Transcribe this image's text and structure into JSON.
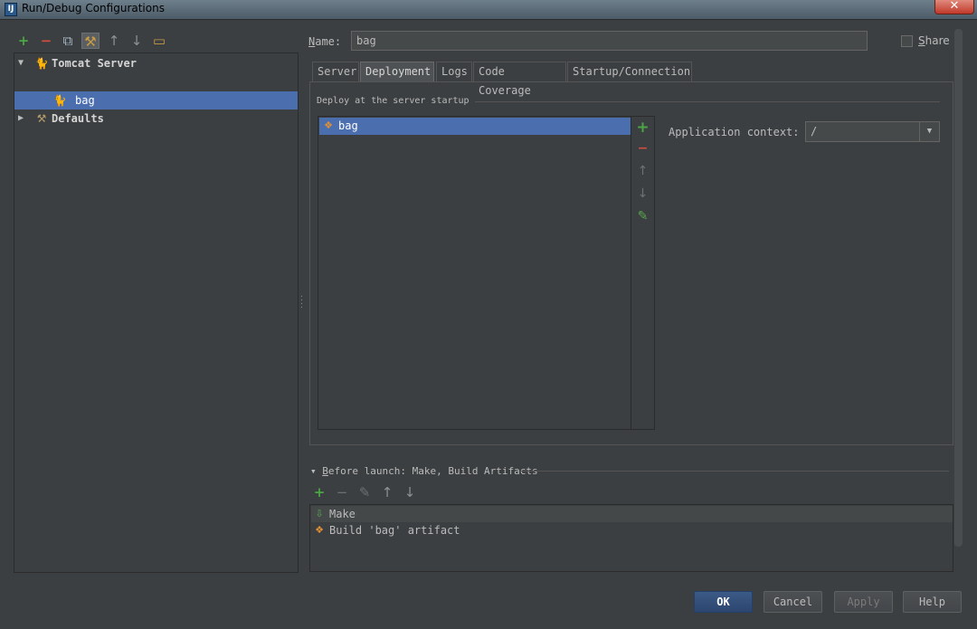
{
  "window": {
    "title": "Run/Debug Configurations",
    "logo_text": "IJ",
    "close_glyph": "✕"
  },
  "left_toolbar": [
    {
      "name": "add-icon",
      "glyph": "+"
    },
    {
      "name": "remove-icon",
      "glyph": "−"
    },
    {
      "name": "copy-icon",
      "glyph": "⧉"
    },
    {
      "name": "edit-defaults-icon",
      "glyph": "⚒"
    },
    {
      "name": "move-up-icon",
      "glyph": "↑"
    },
    {
      "name": "move-down-icon",
      "glyph": "↓"
    },
    {
      "name": "folder-icon",
      "glyph": "▭"
    }
  ],
  "tree": {
    "tomcat": {
      "label": "Tomcat Server",
      "expanded_glyph": "▼",
      "icon_glyph": "🐈"
    },
    "bag": {
      "label": "bag",
      "icon_glyph": "🐈"
    },
    "defaults": {
      "label": "Defaults",
      "collapsed_glyph": "▶",
      "icon_glyph": "⚒"
    }
  },
  "name_field": {
    "label_prefix": "N",
    "label_rest": "ame:",
    "value": "bag"
  },
  "share": {
    "label_prefix": "S",
    "label_rest": "hare",
    "checked": false
  },
  "tabs": [
    "Server",
    "Deployment",
    "Logs",
    "Code Coverage",
    "Startup/Connection"
  ],
  "active_tab": "Deployment",
  "deploy": {
    "group_title": "Deploy at the server startup",
    "items": [
      {
        "label": "bag",
        "icon_glyph": "❖"
      }
    ],
    "side_tools": [
      "+",
      "−",
      "↑",
      "↓",
      "✎"
    ]
  },
  "app_context": {
    "label": "Application context:",
    "value": "/",
    "arrow_glyph": "▼"
  },
  "before_launch": {
    "title_prefix": "▾ ",
    "title_u": "B",
    "title_rest": "efore launch: Make, Build Artifacts",
    "tools": [
      "+",
      "−",
      "✎",
      "↑",
      "↓"
    ],
    "items": [
      {
        "label": "Make",
        "icon_glyph": "⇩"
      },
      {
        "label": "Build 'bag' artifact",
        "icon_glyph": "❖"
      }
    ]
  },
  "buttons": {
    "ok": "OK",
    "cancel": "Cancel",
    "apply": "Apply",
    "help": "Help"
  },
  "colors": {
    "accent": "#4b6eaf",
    "background": "#3c3f41",
    "add": "#4ca544",
    "remove": "#d04e3f"
  }
}
